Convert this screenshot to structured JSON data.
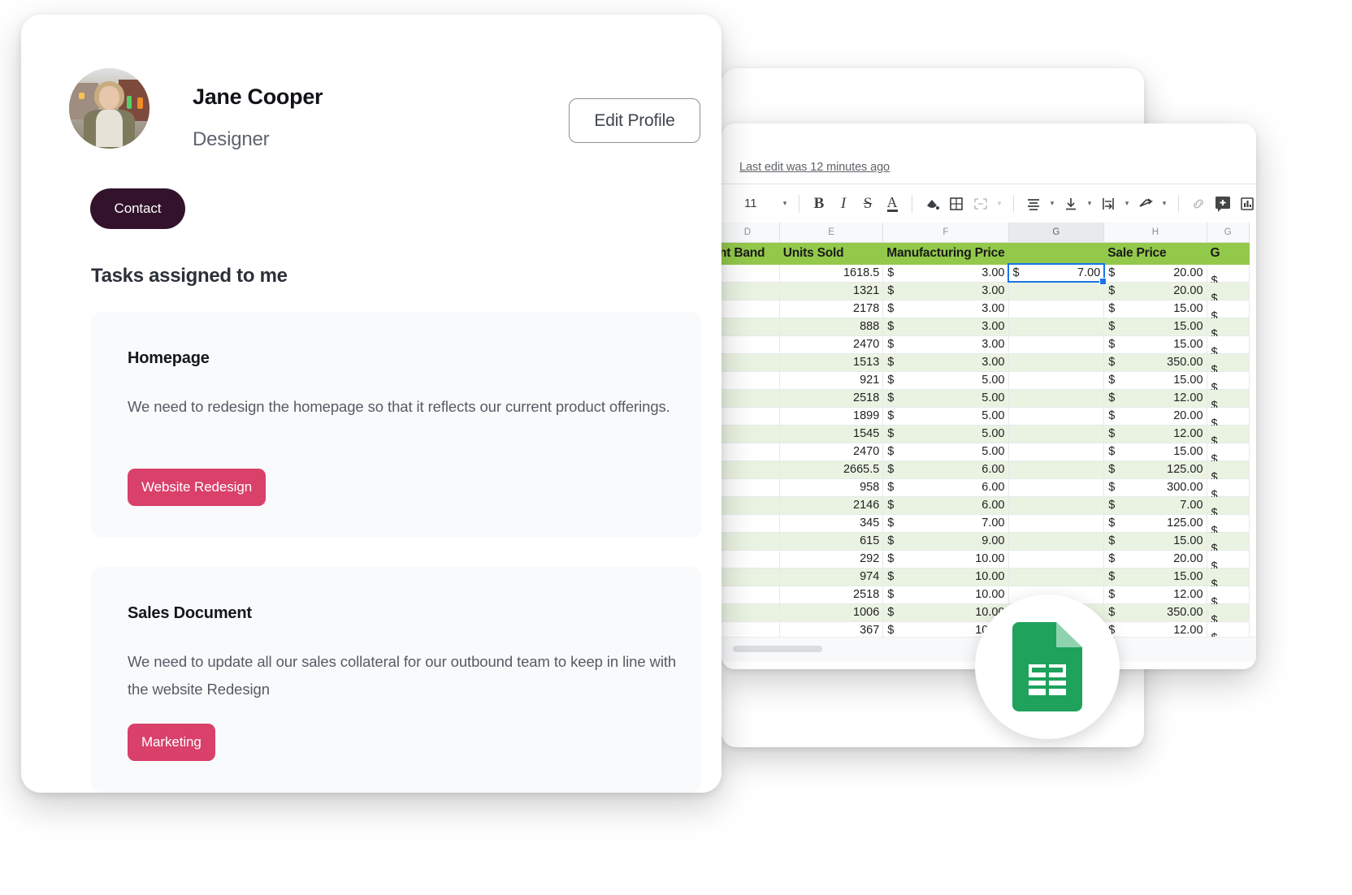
{
  "profile": {
    "name": "Jane Cooper",
    "role": "Designer",
    "edit_label": "Edit Profile",
    "contact_label": "Contact",
    "tasks_title": "Tasks assigned to me",
    "accent_tag_color": "#d9406a",
    "contact_button_color": "#32132b",
    "tasks": [
      {
        "title": "Homepage",
        "description": "We need to redesign the homepage so that it reflects our current product offerings.",
        "tag": "Website Redesign"
      },
      {
        "title": "Sales Document",
        "description": "We need to update all our sales collateral for our outbound team to keep in line with the website Redesign",
        "tag": "Marketing"
      }
    ]
  },
  "spreadsheet": {
    "last_edit": "Last edit was 12 minutes ago",
    "font_size": "11",
    "toolbar": [
      {
        "name": "font-size-value",
        "glyph": "11"
      },
      {
        "name": "font-size-dropdown-caret-icon",
        "glyph": "▾"
      },
      {
        "name": "bold-icon",
        "glyph": "B"
      },
      {
        "name": "italic-icon",
        "glyph": "I"
      },
      {
        "name": "strikethrough-icon",
        "glyph": "S"
      },
      {
        "name": "text-color-icon",
        "glyph": "A"
      },
      {
        "name": "fill-color-icon",
        "glyph": "◆"
      },
      {
        "name": "borders-icon",
        "glyph": "⊞"
      },
      {
        "name": "merge-cells-icon",
        "glyph": "❐"
      },
      {
        "name": "merge-caret-icon",
        "glyph": "▾"
      },
      {
        "name": "horizontal-align-icon",
        "glyph": "☰"
      },
      {
        "name": "horizontal-align-caret-icon",
        "glyph": "▾"
      },
      {
        "name": "vertical-align-icon",
        "glyph": "⤓"
      },
      {
        "name": "vertical-align-caret-icon",
        "glyph": "▾"
      },
      {
        "name": "text-wrapping-icon",
        "glyph": "↦"
      },
      {
        "name": "text-wrapping-caret-icon",
        "glyph": "▾"
      },
      {
        "name": "text-rotation-icon",
        "glyph": "➤"
      },
      {
        "name": "text-rotation-caret-icon",
        "glyph": "▾"
      },
      {
        "name": "insert-link-icon",
        "glyph": "⚭"
      },
      {
        "name": "insert-comment-icon",
        "glyph": "+"
      },
      {
        "name": "insert-chart-icon",
        "glyph": "Ὄa"
      },
      {
        "name": "filter-icon",
        "glyph": "▽"
      },
      {
        "name": "filter-caret-icon",
        "glyph": "▾"
      }
    ],
    "column_letters": [
      "D",
      "E",
      "F",
      "G",
      "H",
      "G"
    ],
    "selected_column": "G",
    "selected_cell_value": "7.00",
    "headers": [
      "nt Band",
      "Units Sold",
      "Manufacturing Price",
      "",
      "Sale Price",
      "G"
    ],
    "header_fill": "#93c94b",
    "band_fill": "#eaf3e2",
    "rows": [
      {
        "band": "",
        "units": "1618.5",
        "mfg": "3.00",
        "g": "7.00",
        "sale": "20.00"
      },
      {
        "band": "",
        "units": "1321",
        "mfg": "3.00",
        "g": "",
        "sale": "20.00"
      },
      {
        "band": "",
        "units": "2178",
        "mfg": "3.00",
        "g": "",
        "sale": "15.00"
      },
      {
        "band": "",
        "units": "888",
        "mfg": "3.00",
        "g": "",
        "sale": "15.00"
      },
      {
        "band": "",
        "units": "2470",
        "mfg": "3.00",
        "g": "",
        "sale": "15.00"
      },
      {
        "band": "",
        "units": "1513",
        "mfg": "3.00",
        "g": "",
        "sale": "350.00"
      },
      {
        "band": "",
        "units": "921",
        "mfg": "5.00",
        "g": "",
        "sale": "15.00"
      },
      {
        "band": "",
        "units": "2518",
        "mfg": "5.00",
        "g": "",
        "sale": "12.00"
      },
      {
        "band": "",
        "units": "1899",
        "mfg": "5.00",
        "g": "",
        "sale": "20.00"
      },
      {
        "band": "",
        "units": "1545",
        "mfg": "5.00",
        "g": "",
        "sale": "12.00"
      },
      {
        "band": "",
        "units": "2470",
        "mfg": "5.00",
        "g": "",
        "sale": "15.00"
      },
      {
        "band": "",
        "units": "2665.5",
        "mfg": "6.00",
        "g": "",
        "sale": "125.00"
      },
      {
        "band": "",
        "units": "958",
        "mfg": "6.00",
        "g": "",
        "sale": "300.00"
      },
      {
        "band": "",
        "units": "2146",
        "mfg": "6.00",
        "g": "",
        "sale": "7.00"
      },
      {
        "band": "",
        "units": "345",
        "mfg": "7.00",
        "g": "",
        "sale": "125.00"
      },
      {
        "band": "",
        "units": "615",
        "mfg": "9.00",
        "g": "",
        "sale": "15.00"
      },
      {
        "band": "",
        "units": "292",
        "mfg": "10.00",
        "g": "",
        "sale": "20.00"
      },
      {
        "band": "",
        "units": "974",
        "mfg": "10.00",
        "g": "",
        "sale": "15.00"
      },
      {
        "band": "",
        "units": "2518",
        "mfg": "10.00",
        "g": "",
        "sale": "12.00"
      },
      {
        "band": "",
        "units": "1006",
        "mfg": "10.00",
        "g": "",
        "sale": "350.00"
      },
      {
        "band": "",
        "units": "367",
        "mfg": "10.00",
        "g": "",
        "sale": "12.00"
      }
    ]
  },
  "sheets_icon": {
    "name": "google-sheets-icon",
    "color": "#1ea25c"
  }
}
